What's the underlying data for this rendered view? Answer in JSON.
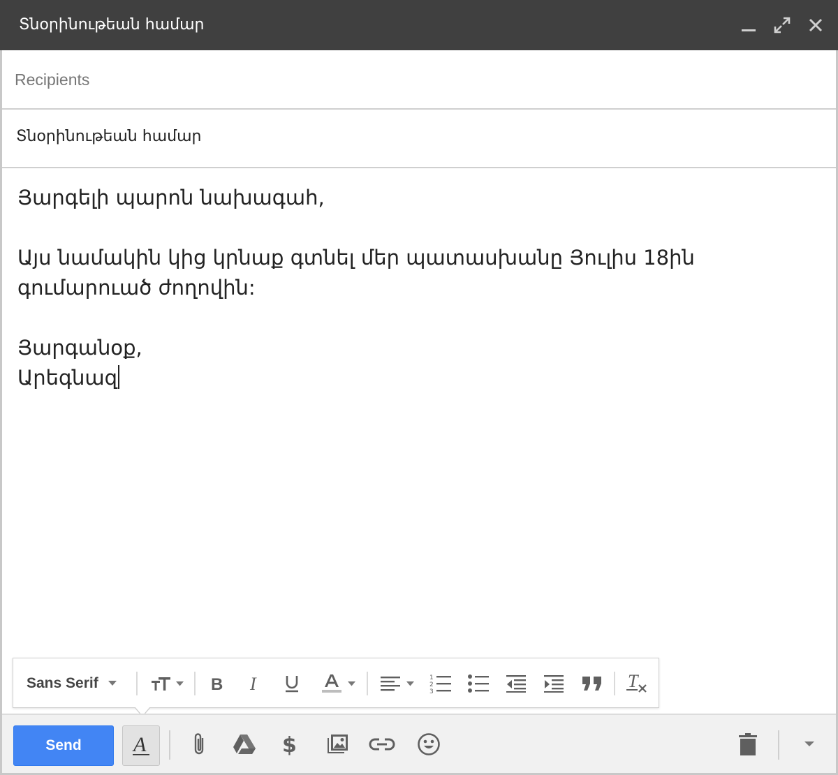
{
  "window": {
    "title": "Տնօրինութեան համար"
  },
  "recipients": {
    "placeholder": "Recipients",
    "value": ""
  },
  "subject": {
    "value": "Տնօրինութեան համար"
  },
  "body": {
    "lines": [
      "Յարգելի պարոն նախագահ,",
      "",
      "Այս նամակին կից կրնաք գտնել մեր պատասխանը Յուլիս 18ին",
      "գումարուած ժողովին:",
      "",
      "Յարգանօք,",
      "Արեգնազ"
    ]
  },
  "format_toolbar": {
    "font_family": "Sans Serif"
  },
  "bottom_toolbar": {
    "send_label": "Send"
  },
  "colors": {
    "titlebar": "#404040",
    "send": "#4285f4",
    "icon": "#5f5f5f"
  }
}
